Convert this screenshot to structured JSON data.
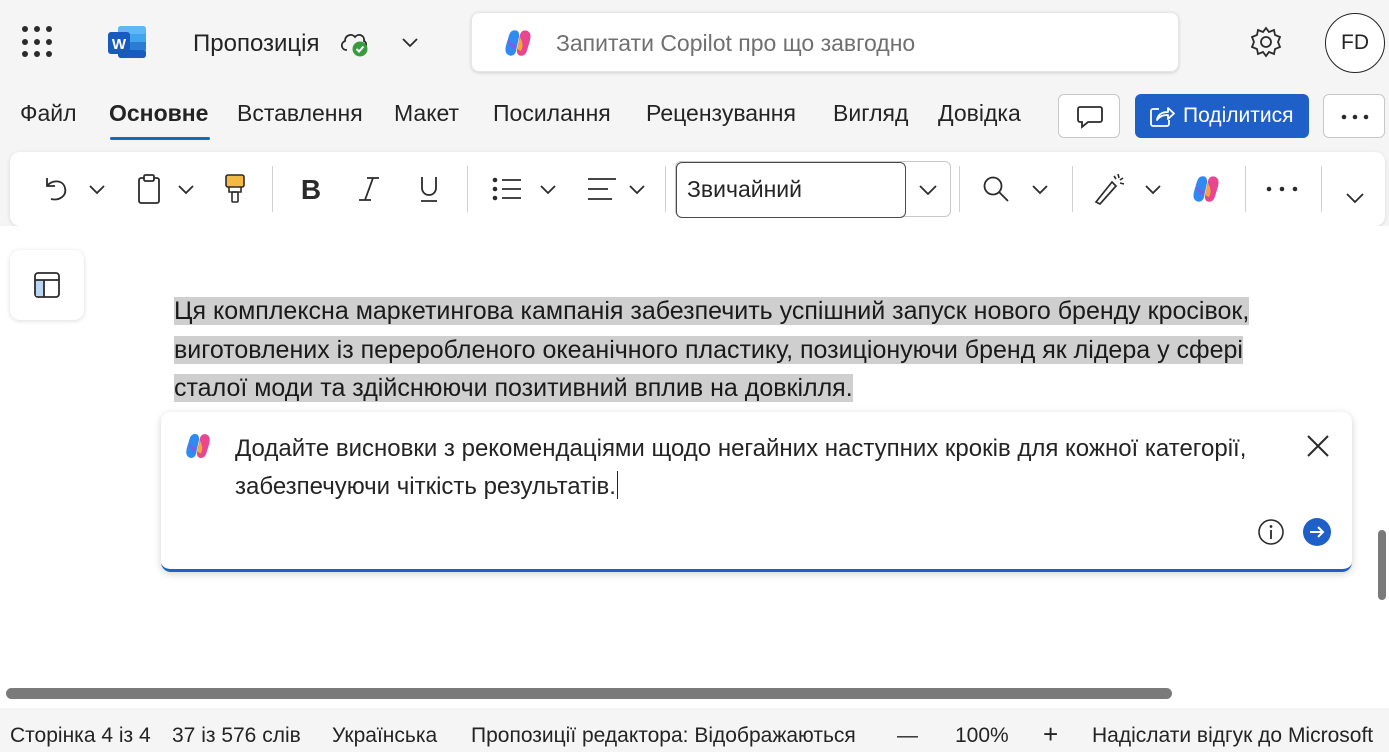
{
  "app": {
    "doc_title": "Пропозиція",
    "copilot_placeholder": "Запитати Copilot про що завгодно",
    "avatar_initials": "FD",
    "icons": [
      "waffle-icon",
      "word-logo-icon",
      "cloud-synced-icon",
      "chevron-down-icon",
      "copilot-icon",
      "gear-icon"
    ]
  },
  "menu": {
    "tabs": [
      {
        "label": "Файл",
        "active": false
      },
      {
        "label": "Основне",
        "active": true
      },
      {
        "label": "Вставлення",
        "active": false
      },
      {
        "label": "Макет",
        "active": false
      },
      {
        "label": "Посилання",
        "active": false
      },
      {
        "label": "Рецензування",
        "active": false
      },
      {
        "label": "Вигляд",
        "active": false
      },
      {
        "label": "Довідка",
        "active": false
      }
    ],
    "share_label": "Поділитися",
    "accent": "#1f5fc8"
  },
  "ribbon": {
    "style_value": "Звичайний",
    "icons": [
      "undo-icon",
      "clipboard-icon",
      "format-painter-icon",
      "bold-icon",
      "italic-icon",
      "underline-icon",
      "bullets-icon",
      "align-icon",
      "find-icon",
      "designer-icon",
      "copilot-icon",
      "more-icon",
      "expand-icon"
    ]
  },
  "document": {
    "paragraph": "Ця комплексна маркетингова кампанія забезпечить успішний запуск нового бренду кросівок, виготовлених із переробленого океанічного пластику, позиціонуючи бренд як лідера у сфері сталої моди та здійснюючи позитивний вплив на довкілля.",
    "copilot_prompt": "Додайте висновки з рекомендаціями щодо негайних наступних кроків для кожної категорії, забезпечуючи чіткість результатів."
  },
  "status": {
    "page": "Сторінка 4 із 4",
    "words": "37 із 576 слів",
    "language": "Українська",
    "editor": "Пропозиції редактора: Відображаються",
    "zoom_minus": "—",
    "zoom": "100%",
    "zoom_plus": "+",
    "feedback": "Надіслати відгук до Microsoft"
  }
}
